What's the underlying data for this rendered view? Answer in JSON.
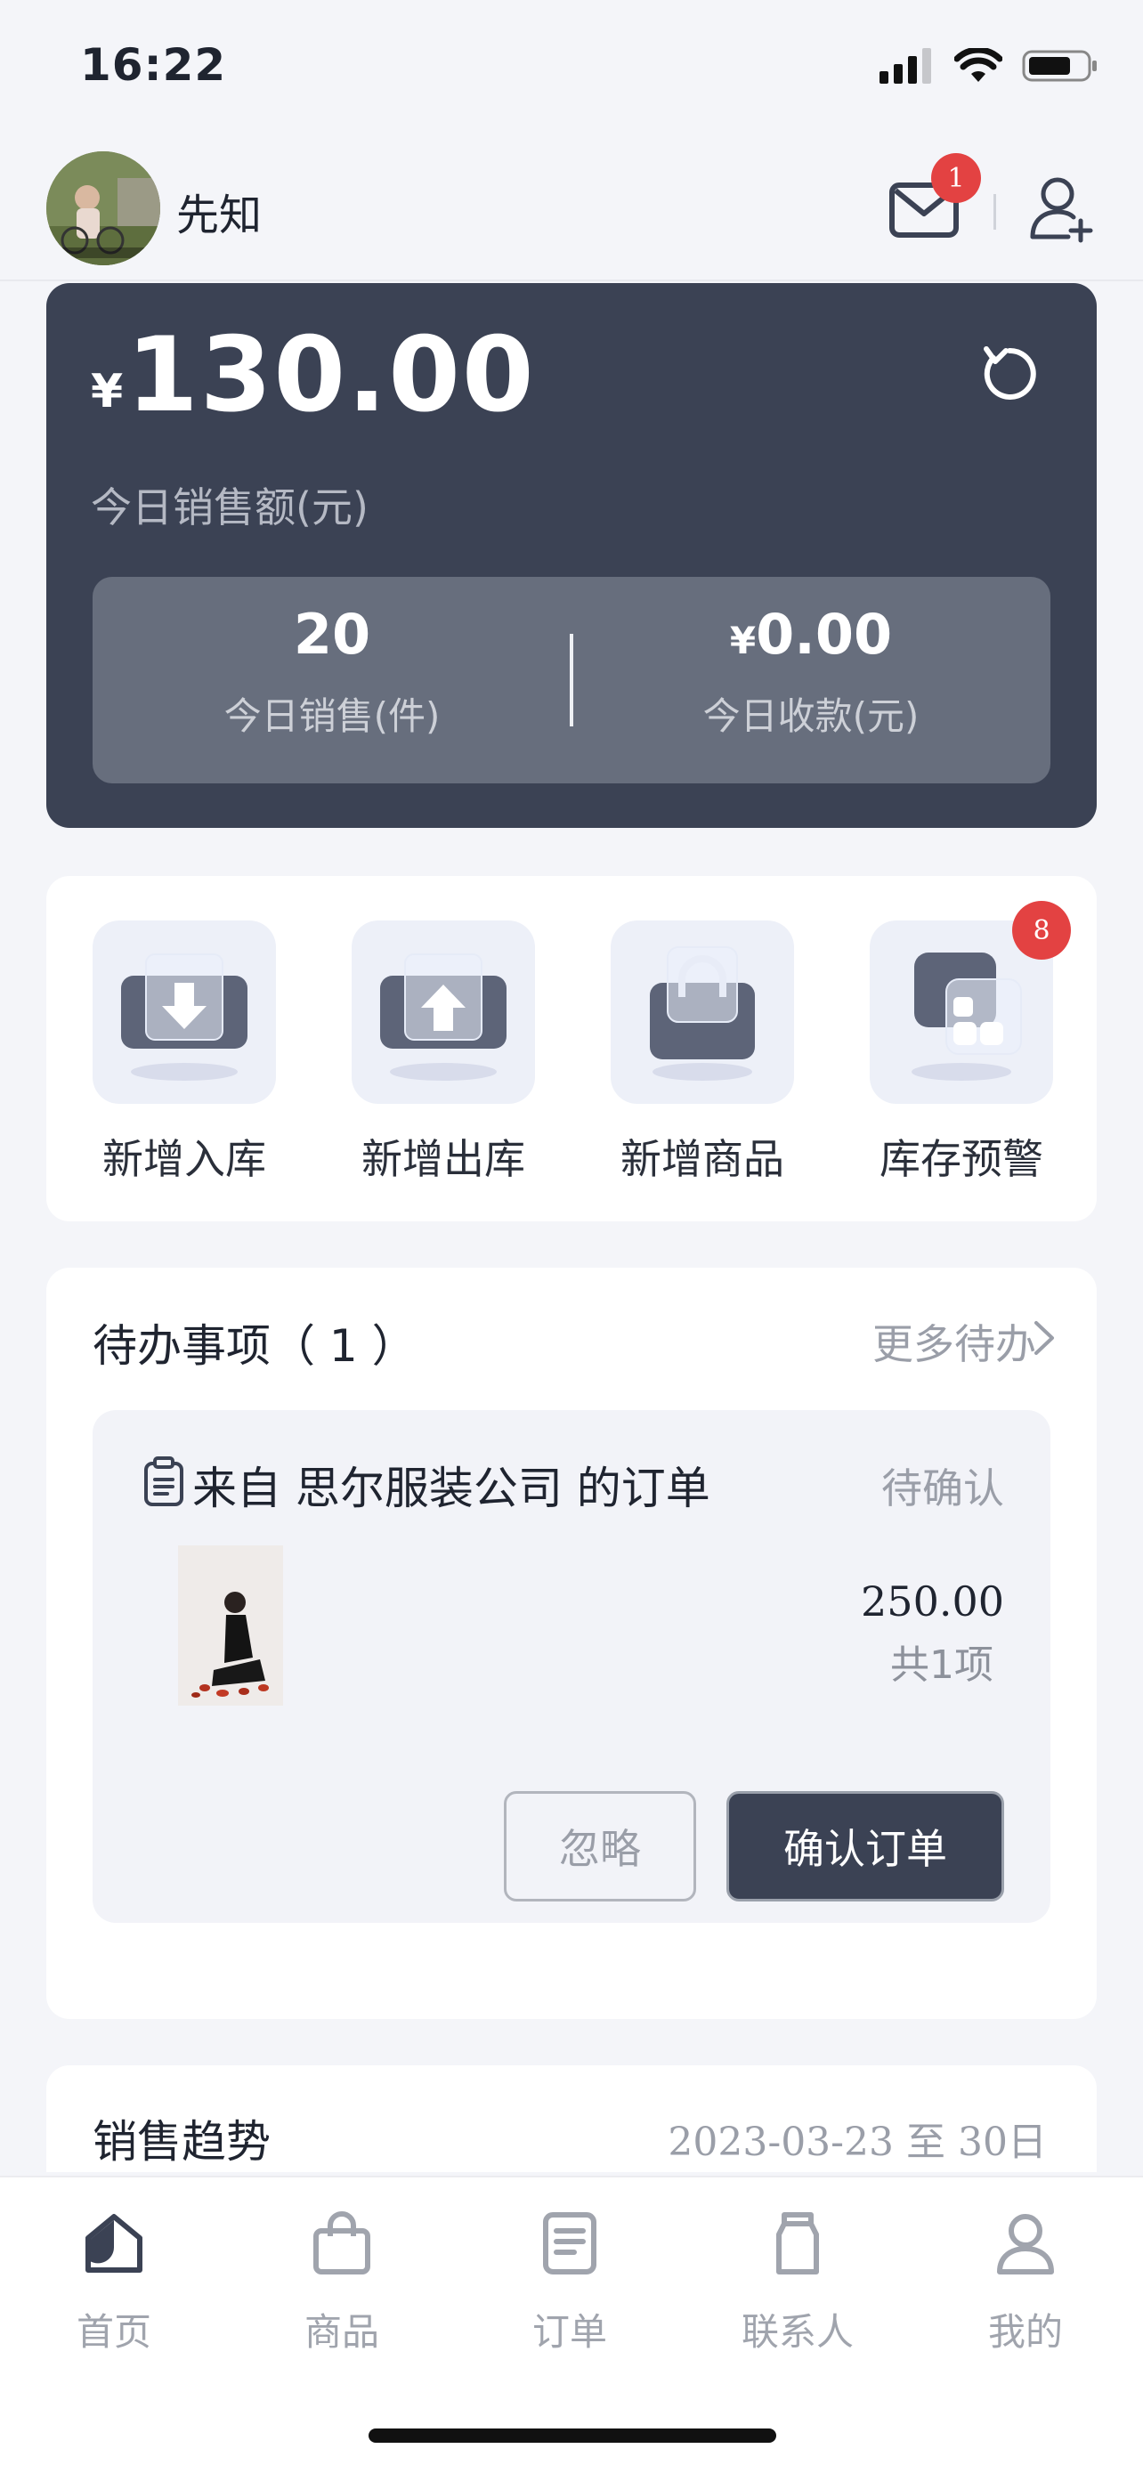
{
  "status_bar": {
    "time": "16:22"
  },
  "header": {
    "username": "先知",
    "mail_badge": "1"
  },
  "sales": {
    "currency": "¥",
    "amount": "130.00",
    "amount_label": "今日销售额(元)",
    "stats": [
      {
        "currency": "",
        "value": "20",
        "label": "今日销售(件)"
      },
      {
        "currency": "¥",
        "value": "0.00",
        "label": "今日收款(元)"
      }
    ]
  },
  "quick_actions": [
    {
      "label": "新增入库",
      "icon": "stock-in-icon"
    },
    {
      "label": "新增出库",
      "icon": "stock-out-icon"
    },
    {
      "label": "新增商品",
      "icon": "add-product-icon"
    },
    {
      "label": "库存预警",
      "icon": "stock-warning-icon",
      "badge": "8"
    }
  ],
  "todo": {
    "title": "待办事项（ 1 ）",
    "more": "更多待办",
    "order": {
      "title": "来自 思尔服装公司 的订单",
      "status": "待确认",
      "price": "250.00",
      "count": "共1项",
      "ignore_label": "忽略",
      "confirm_label": "确认订单"
    }
  },
  "trend": {
    "title": "销售趋势",
    "range": "2023-03-23 至 30日"
  },
  "tabbar": [
    {
      "label": "首页",
      "icon": "home-icon"
    },
    {
      "label": "商品",
      "icon": "bag-icon"
    },
    {
      "label": "订单",
      "icon": "order-icon"
    },
    {
      "label": "联系人",
      "icon": "contacts-icon"
    },
    {
      "label": "我的",
      "icon": "profile-icon"
    }
  ],
  "colors": {
    "card_dark": "#3b4254",
    "badge": "#e34242",
    "page_bg": "#f4f5f9"
  }
}
